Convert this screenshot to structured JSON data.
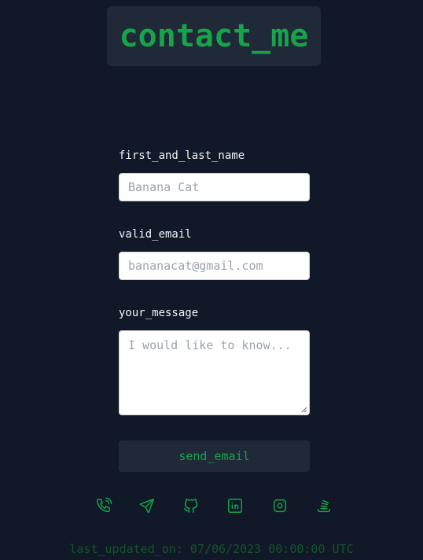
{
  "header": {
    "title": "contact_me"
  },
  "form": {
    "name_label": "first_and_last_name",
    "name_placeholder": "Banana Cat",
    "email_label": "valid_email",
    "email_placeholder": "bananacat@gmail.com",
    "message_label": "your_message",
    "message_placeholder": "I would like to know...",
    "submit_label": "send_email"
  },
  "social": {
    "icons": [
      "phone-icon",
      "send-icon",
      "github-icon",
      "linkedin-icon",
      "instagram-icon",
      "stackoverflow-icon"
    ]
  },
  "footer": {
    "text": "last_updated_on: 07/06/2023 00:00:00 UTC"
  },
  "colors": {
    "background": "#111827",
    "panel": "#1f2937",
    "accent": "#16a34a",
    "footer_text": "#14532d"
  }
}
